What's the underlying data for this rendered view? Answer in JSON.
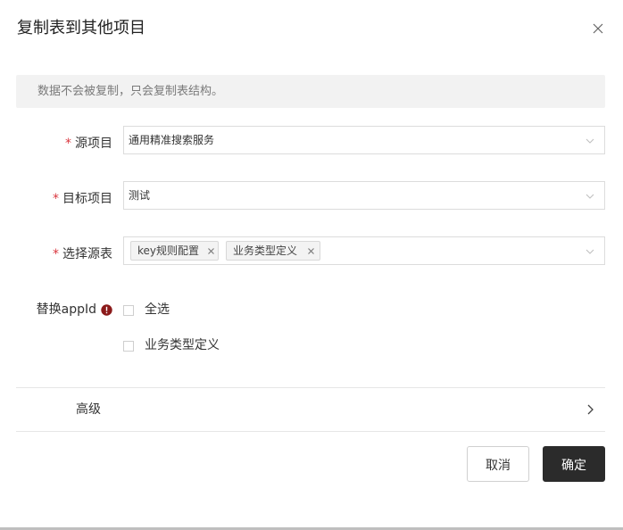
{
  "dialog": {
    "title": "复制表到其他项目",
    "notice": "数据不会被复制，只会复制表结构。"
  },
  "form": {
    "required_mark": "*",
    "source_project": {
      "label": "源项目",
      "value": "通用精准搜索服务"
    },
    "target_project": {
      "label": "目标项目",
      "value": "测试"
    },
    "source_tables": {
      "label": "选择源表",
      "tags": [
        "key规则配置",
        "业务类型定义"
      ]
    },
    "replace_appid": {
      "label": "替换appId",
      "options": [
        {
          "label": "全选",
          "checked": false
        },
        {
          "label": "业务类型定义",
          "checked": false
        }
      ]
    },
    "advanced": {
      "label": "高级"
    }
  },
  "buttons": {
    "cancel": "取消",
    "ok": "确定"
  },
  "colors": {
    "required": "#d9363e",
    "primary_button": "#2b2b2b",
    "info_icon": "#8b1a1a",
    "notice_bg": "#f2f2f2"
  },
  "icons": {
    "close": "close-icon",
    "dropdown": "chevron-down-icon",
    "tag_remove": "tag-close-icon",
    "info": "info-circle-icon",
    "expand": "chevron-right-icon"
  }
}
